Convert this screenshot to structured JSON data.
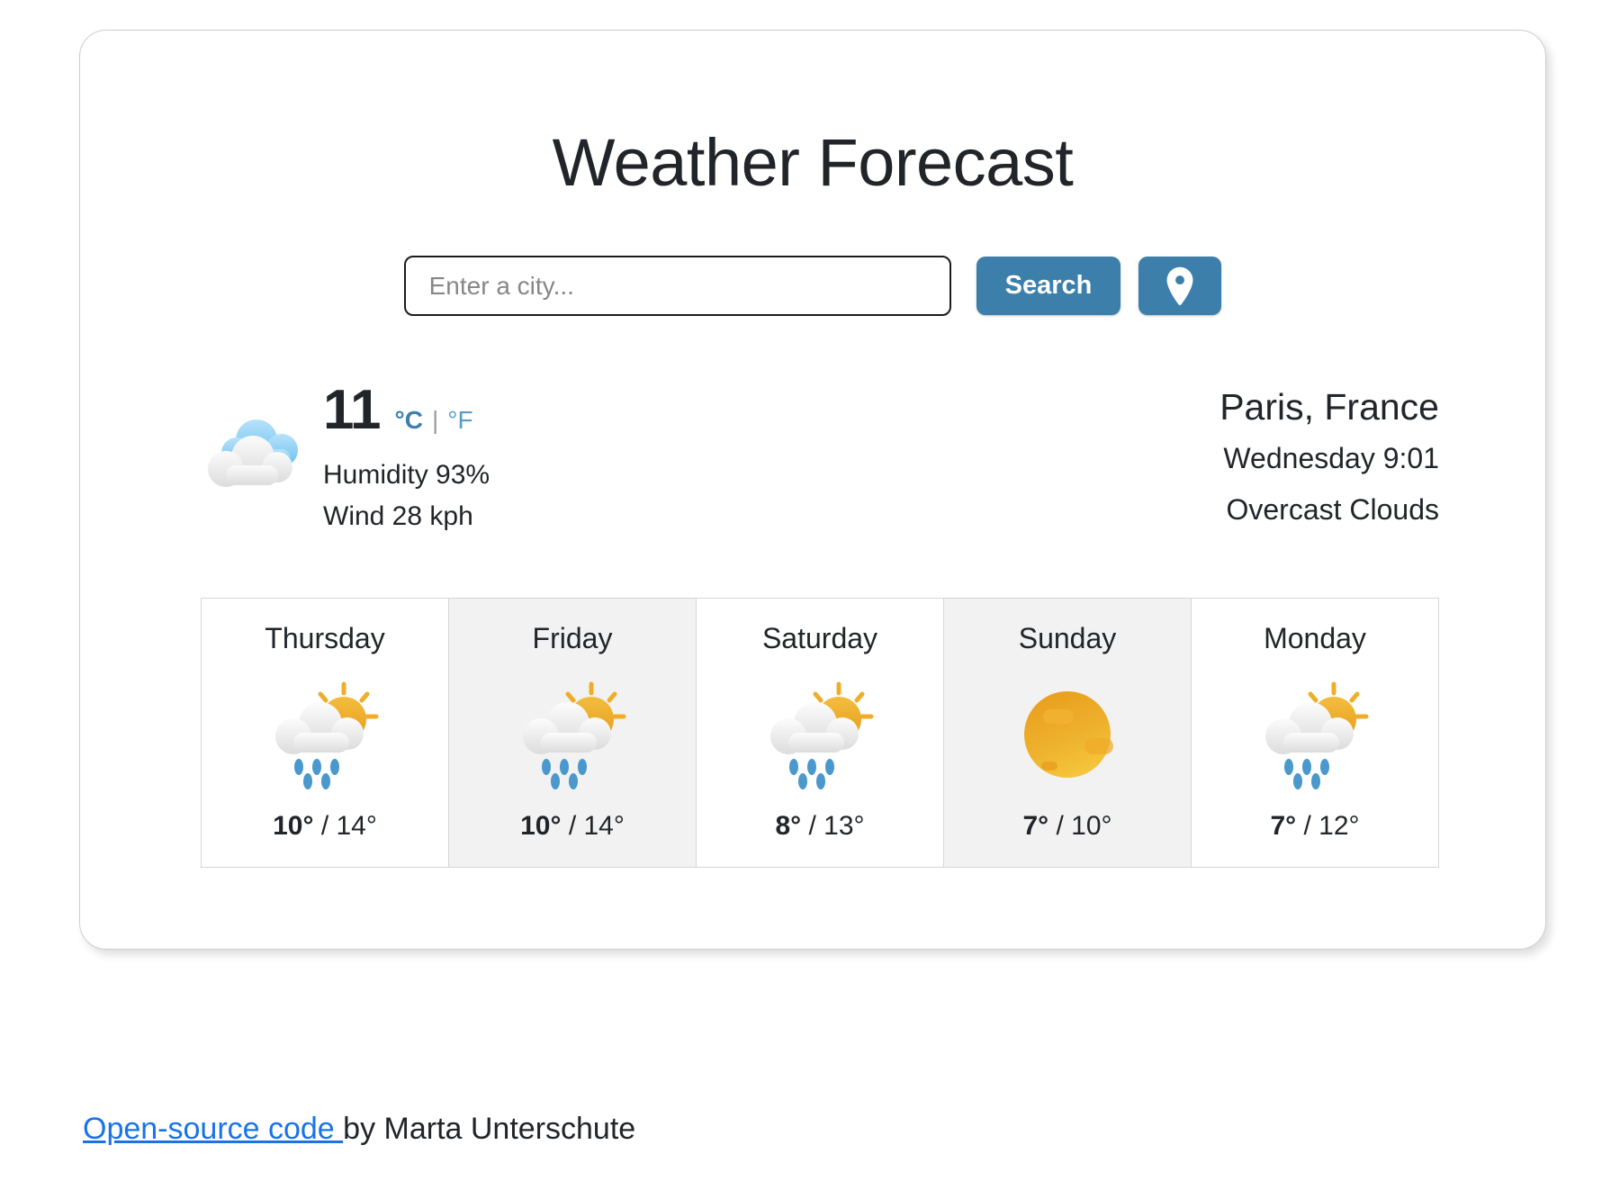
{
  "header": {
    "title": "Weather Forecast"
  },
  "search": {
    "placeholder": "Enter a city...",
    "value": "",
    "search_label": "Search",
    "geo_icon": "location-pin-icon"
  },
  "current": {
    "icon": "overcast-clouds-icon",
    "temperature": "11",
    "unit_celsius": "°C",
    "unit_separator": "|",
    "unit_fahrenheit": "°F",
    "humidity": "Humidity 93%",
    "wind": "Wind 28 kph",
    "city": "Paris, France",
    "datetime": "Wednesday 9:01",
    "condition": "Overcast Clouds"
  },
  "forecast": [
    {
      "day": "Thursday",
      "icon": "sun-cloud-rain-icon",
      "temp_max": "10°",
      "separator": " / ",
      "temp_min": "14°"
    },
    {
      "day": "Friday",
      "icon": "sun-cloud-rain-icon",
      "temp_max": "10°",
      "separator": " / ",
      "temp_min": "14°"
    },
    {
      "day": "Saturday",
      "icon": "sun-cloud-rain-icon",
      "temp_max": "8°",
      "separator": " / ",
      "temp_min": "13°"
    },
    {
      "day": "Sunday",
      "icon": "sun-icon",
      "temp_max": "7°",
      "separator": " / ",
      "temp_min": "10°"
    },
    {
      "day": "Monday",
      "icon": "sun-cloud-rain-icon",
      "temp_max": "7°",
      "separator": " / ",
      "temp_min": "12°"
    }
  ],
  "footer": {
    "link_text": "Open-source code ",
    "author_text": "by Marta Unterschute"
  },
  "colors": {
    "accent_blue": "#3c7fab",
    "link_blue": "#1a73e8",
    "unit_link_blue": "#5b9bc6",
    "text_dark": "#212529",
    "alt_cell": "#f2f2f2",
    "sun_orange": "#eda527"
  }
}
